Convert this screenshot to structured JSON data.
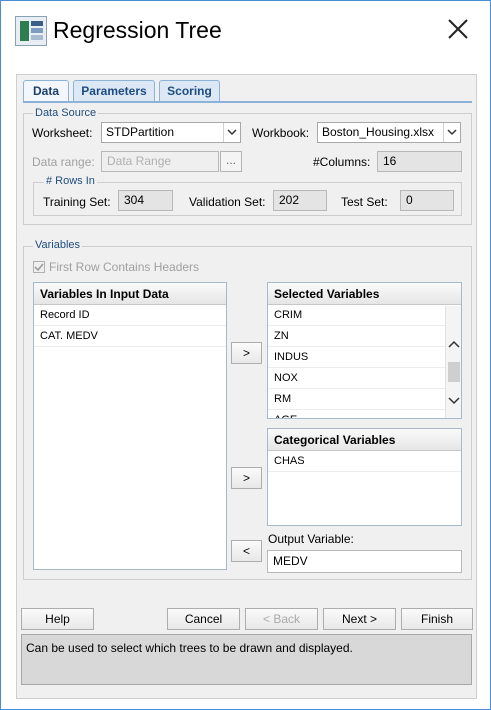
{
  "window": {
    "title": "Regression Tree"
  },
  "tabs": [
    {
      "label": "Data",
      "active": true
    },
    {
      "label": "Parameters",
      "active": false
    },
    {
      "label": "Scoring",
      "active": false
    }
  ],
  "data_source": {
    "legend": "Data Source",
    "worksheet_label": "Worksheet:",
    "worksheet_value": "STDPartition",
    "workbook_label": "Workbook:",
    "workbook_value": "Boston_Housing.xlsx",
    "data_range_label": "Data range:",
    "data_range_placeholder": "Data Range",
    "browse_label": "...",
    "columns_label": "#Columns:",
    "columns_value": "16",
    "rows_legend": "# Rows In",
    "training_label": "Training Set:",
    "training_value": "304",
    "validation_label": "Validation Set:",
    "validation_value": "202",
    "test_label": "Test Set:",
    "test_value": "0"
  },
  "variables": {
    "legend": "Variables",
    "first_row_label": "First Row Contains Headers",
    "input_header": "Variables In Input Data",
    "input_items": [
      "Record ID",
      "CAT. MEDV"
    ],
    "selected_header": "Selected Variables",
    "selected_items": [
      "CRIM",
      "ZN",
      "INDUS",
      "NOX",
      "RM",
      "AGE"
    ],
    "categorical_header": "Categorical Variables",
    "categorical_items": [
      "CHAS"
    ],
    "output_label": "Output Variable:",
    "output_value": "MEDV",
    "move_right_1": ">",
    "move_right_2": ">",
    "move_left": "<"
  },
  "buttons": {
    "help": "Help",
    "cancel": "Cancel",
    "back": "< Back",
    "next": "Next >",
    "finish": "Finish"
  },
  "status_text": "Can be used to select which trees to be drawn and displayed."
}
